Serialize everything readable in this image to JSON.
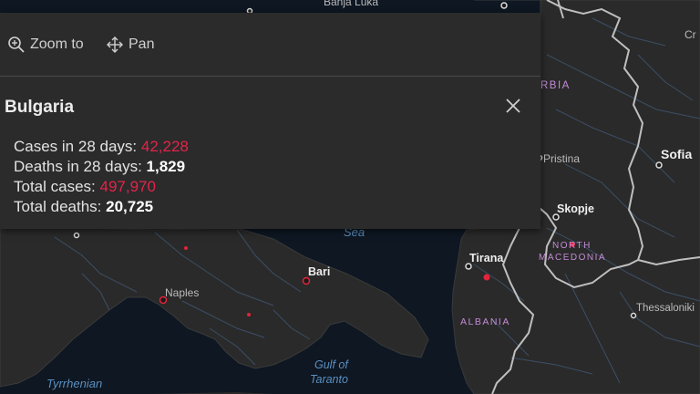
{
  "map": {
    "places": [
      {
        "name": "Banja Luka",
        "kind": "city"
      },
      {
        "name": "Sofia",
        "kind": "city"
      },
      {
        "name": "Pristina",
        "kind": "city"
      },
      {
        "name": "Skopje",
        "kind": "city"
      },
      {
        "name": "Tirana",
        "kind": "city"
      },
      {
        "name": "Bari",
        "kind": "city"
      },
      {
        "name": "Naples",
        "kind": "city"
      },
      {
        "name": "Thessaloniki",
        "kind": "city"
      },
      {
        "name": "Cr",
        "kind": "city"
      }
    ],
    "countries": [
      {
        "name": "RBIA"
      },
      {
        "name": "NORTH"
      },
      {
        "name": "MACEDONIA"
      },
      {
        "name": "ALBANIA"
      }
    ],
    "water": [
      {
        "name": "Sea"
      },
      {
        "name": "Gulf of"
      },
      {
        "name": "Taranto"
      },
      {
        "name": "Tyrrhenian"
      }
    ]
  },
  "popup": {
    "actions": [
      {
        "label": "Zoom to",
        "icon": "zoom-in-icon"
      },
      {
        "label": "Pan",
        "icon": "pan-arrows-icon"
      }
    ],
    "title": "Bulgaria",
    "close_icon": "close-icon",
    "stats": [
      {
        "label": "Cases in 28 days:",
        "value": "42,228",
        "color": "#e3244a"
      },
      {
        "label": "Deaths in 28 days:",
        "value": "1,829",
        "color": "#ffffff"
      },
      {
        "label": "Total cases:",
        "value": "497,970",
        "color": "#e3244a"
      },
      {
        "label": "Total deaths:",
        "value": "20,725",
        "color": "#ffffff"
      }
    ]
  },
  "colors": {
    "water": "#0e1722",
    "land": "#2a2a2a",
    "popup_bg": "#2b2b2b",
    "country_label": "#c48bd6",
    "water_label": "#5b8fc0",
    "case_dot": "#e3243a"
  }
}
